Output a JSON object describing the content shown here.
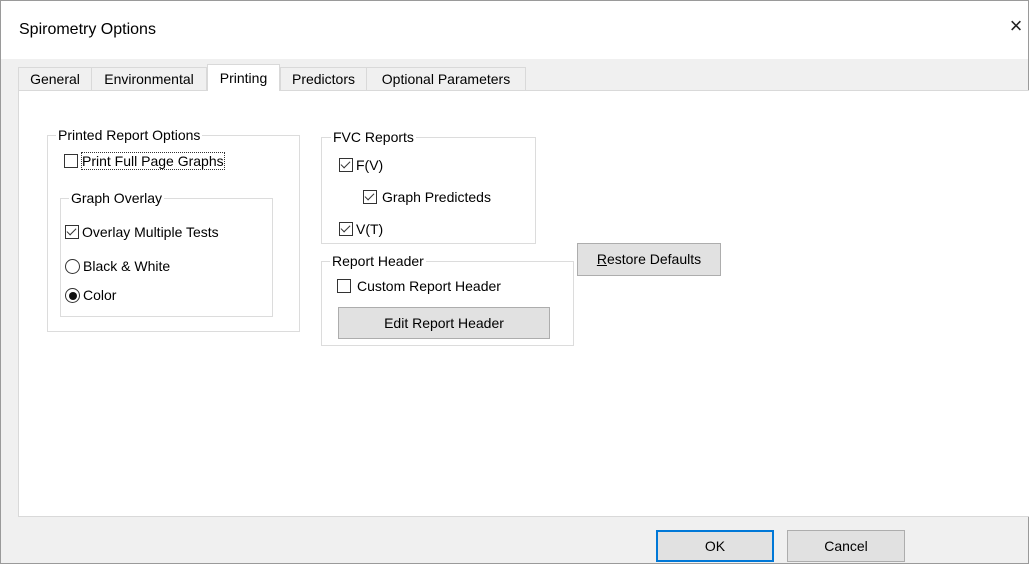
{
  "window": {
    "title": "Spirometry Options",
    "close_glyph": "×"
  },
  "tabs": [
    {
      "label": "General",
      "active": false
    },
    {
      "label": "Environmental",
      "active": false
    },
    {
      "label": "Printing",
      "active": true
    },
    {
      "label": "Predictors",
      "active": false
    },
    {
      "label": "Optional Parameters",
      "active": false
    }
  ],
  "printed_report_options": {
    "label": "Printed Report Options",
    "print_full_page_graphs": {
      "label": "Print Full Page Graphs",
      "checked": false
    },
    "graph_overlay": {
      "label": "Graph Overlay",
      "overlay_multiple_tests": {
        "label": "Overlay Multiple Tests",
        "checked": true
      },
      "black_white": {
        "label": "Black & White",
        "selected": false
      },
      "color": {
        "label": "Color",
        "selected": true
      }
    }
  },
  "fvc_reports": {
    "label": "FVC Reports",
    "fv": {
      "label": "F(V)",
      "checked": true
    },
    "graph_predicteds": {
      "label": "Graph Predicteds",
      "checked": true
    },
    "vt": {
      "label": "V(T)",
      "checked": true
    }
  },
  "report_header": {
    "label": "Report Header",
    "custom_report_header": {
      "label": "Custom Report Header",
      "checked": false
    },
    "edit_button": "Edit Report Header"
  },
  "restore_defaults": {
    "label_prefix": "R",
    "label_rest": "estore Defaults"
  },
  "footer": {
    "ok": "OK",
    "cancel": "Cancel"
  },
  "colors": {
    "accent": "#0078d7",
    "panel": "#ffffff",
    "chrome": "#f0f0f0"
  }
}
